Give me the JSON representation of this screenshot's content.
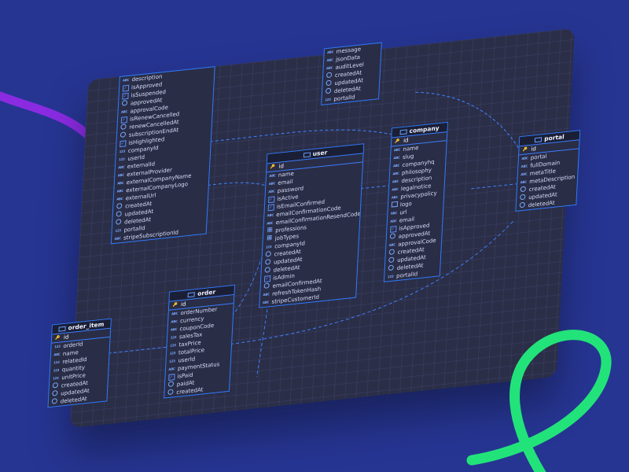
{
  "diagram": {
    "tables": [
      {
        "id": "partial_top",
        "title": "",
        "rows": [
          {
            "name": "message",
            "icon": "abc"
          },
          {
            "name": "jsonData",
            "icon": "abc"
          },
          {
            "name": "auditLevel",
            "icon": "abc"
          },
          {
            "name": "createdAt",
            "icon": "clock"
          },
          {
            "name": "updatedAt",
            "icon": "clock"
          },
          {
            "name": "deletedAt",
            "icon": "clock"
          },
          {
            "name": "portalId",
            "icon": "num"
          }
        ]
      },
      {
        "id": "partial_left",
        "title": "",
        "rows": [
          {
            "name": "description",
            "icon": "abc"
          },
          {
            "name": "isApproved",
            "icon": "check"
          },
          {
            "name": "isSuspended",
            "icon": "check"
          },
          {
            "name": "approvedAt",
            "icon": "clock"
          },
          {
            "name": "approvalCode",
            "icon": "abc"
          },
          {
            "name": "isRenewCancelled",
            "icon": "check"
          },
          {
            "name": "renewCancelledAt",
            "icon": "clock"
          },
          {
            "name": "subscriptionEndAt",
            "icon": "clock"
          },
          {
            "name": "isHighlighted",
            "icon": "check"
          },
          {
            "name": "companyId",
            "icon": "num"
          },
          {
            "name": "userId",
            "icon": "num"
          },
          {
            "name": "externalId",
            "icon": "abc"
          },
          {
            "name": "externalProvider",
            "icon": "abc"
          },
          {
            "name": "externalCompanyName",
            "icon": "abc"
          },
          {
            "name": "externalCompanyLogo",
            "icon": "abc"
          },
          {
            "name": "externalUrl",
            "icon": "abc"
          },
          {
            "name": "createdAt",
            "icon": "clock"
          },
          {
            "name": "updatedAt",
            "icon": "clock"
          },
          {
            "name": "deletedAt",
            "icon": "clock"
          },
          {
            "name": "portalId",
            "icon": "num"
          },
          {
            "name": "stripeSubscriptionId",
            "icon": "abc"
          }
        ]
      },
      {
        "id": "user",
        "title": "user",
        "rows": [
          {
            "name": "id",
            "icon": "key",
            "pk": true
          },
          {
            "name": "name",
            "icon": "abc"
          },
          {
            "name": "email",
            "icon": "abc"
          },
          {
            "name": "password",
            "icon": "abc"
          },
          {
            "name": "isActive",
            "icon": "check"
          },
          {
            "name": "isEmailConfirmed",
            "icon": "check"
          },
          {
            "name": "emailConfirmationCode",
            "icon": "abc"
          },
          {
            "name": "emailConfirmationResendCode",
            "icon": "abc"
          },
          {
            "name": "professions",
            "icon": "grid"
          },
          {
            "name": "jobTypes",
            "icon": "grid"
          },
          {
            "name": "companyId",
            "icon": "num"
          },
          {
            "name": "createdAt",
            "icon": "clock"
          },
          {
            "name": "updatedAt",
            "icon": "clock"
          },
          {
            "name": "deletedAt",
            "icon": "clock"
          },
          {
            "name": "isAdmin",
            "icon": "check"
          },
          {
            "name": "emailConfirmedAt",
            "icon": "clock"
          },
          {
            "name": "refreshTokenHash",
            "icon": "abc"
          },
          {
            "name": "stripeCustomerId",
            "icon": "abc"
          }
        ]
      },
      {
        "id": "company",
        "title": "company",
        "rows": [
          {
            "name": "id",
            "icon": "key",
            "pk": true
          },
          {
            "name": "name",
            "icon": "abc"
          },
          {
            "name": "slug",
            "icon": "abc"
          },
          {
            "name": "companyhq",
            "icon": "abc"
          },
          {
            "name": "philosophy",
            "icon": "abc"
          },
          {
            "name": "description",
            "icon": "abc"
          },
          {
            "name": "legalnotice",
            "icon": "abc"
          },
          {
            "name": "privacypolicy",
            "icon": "abc"
          },
          {
            "name": "logo",
            "icon": "image"
          },
          {
            "name": "url",
            "icon": "abc"
          },
          {
            "name": "email",
            "icon": "abc"
          },
          {
            "name": "isApproved",
            "icon": "check"
          },
          {
            "name": "approvedAt",
            "icon": "clock"
          },
          {
            "name": "approvalCode",
            "icon": "abc"
          },
          {
            "name": "createdAt",
            "icon": "clock"
          },
          {
            "name": "updatedAt",
            "icon": "clock"
          },
          {
            "name": "deletedAt",
            "icon": "clock"
          },
          {
            "name": "portalId",
            "icon": "num"
          }
        ]
      },
      {
        "id": "portal",
        "title": "portal",
        "rows": [
          {
            "name": "id",
            "icon": "key",
            "pk": true
          },
          {
            "name": "portal",
            "icon": "abc"
          },
          {
            "name": "fullDomain",
            "icon": "abc"
          },
          {
            "name": "metaTitle",
            "icon": "abc"
          },
          {
            "name": "metaDescription",
            "icon": "abc"
          },
          {
            "name": "createdAt",
            "icon": "clock"
          },
          {
            "name": "updatedAt",
            "icon": "clock"
          },
          {
            "name": "deletedAt",
            "icon": "clock"
          }
        ]
      },
      {
        "id": "order",
        "title": "order",
        "rows": [
          {
            "name": "id",
            "icon": "key",
            "pk": true
          },
          {
            "name": "orderNumber",
            "icon": "abc"
          },
          {
            "name": "currency",
            "icon": "abc"
          },
          {
            "name": "couponCode",
            "icon": "abc"
          },
          {
            "name": "salesTax",
            "icon": "num"
          },
          {
            "name": "taxPrice",
            "icon": "num"
          },
          {
            "name": "totalPrice",
            "icon": "num"
          },
          {
            "name": "userId",
            "icon": "num"
          },
          {
            "name": "paymentStatus",
            "icon": "abc"
          },
          {
            "name": "isPaid",
            "icon": "check"
          },
          {
            "name": "paidAt",
            "icon": "clock"
          },
          {
            "name": "createdAt",
            "icon": "clock"
          }
        ]
      },
      {
        "id": "order_item",
        "title": "order_item",
        "rows": [
          {
            "name": "id",
            "icon": "key",
            "pk": true
          },
          {
            "name": "orderId",
            "icon": "num"
          },
          {
            "name": "name",
            "icon": "abc"
          },
          {
            "name": "relatedId",
            "icon": "num"
          },
          {
            "name": "quantity",
            "icon": "num"
          },
          {
            "name": "unitPrice",
            "icon": "num"
          },
          {
            "name": "createdAt",
            "icon": "clock"
          },
          {
            "name": "updatedAt",
            "icon": "clock"
          },
          {
            "name": "deletedAt",
            "icon": "clock"
          }
        ]
      }
    ],
    "colors": {
      "page_background": "#263592",
      "canvas_background": "#2b2e47",
      "table_border": "#2f7bff",
      "relation_line": "#3d82ff",
      "purple_stroke": "#8a2be2",
      "green_stroke": "#22e37a"
    }
  }
}
